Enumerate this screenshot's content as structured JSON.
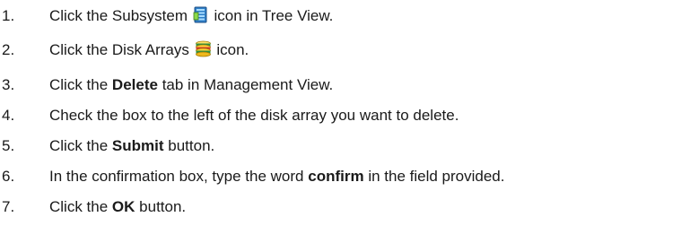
{
  "steps": [
    {
      "number": "1.",
      "before": "Click the Subsystem",
      "icon": "subsystem-icon",
      "after": "icon in Tree View."
    },
    {
      "number": "2.",
      "before": "Click the Disk Arrays",
      "icon": "disk-arrays-icon",
      "after": "icon."
    },
    {
      "number": "3.",
      "before": "Click the",
      "bold": "Delete",
      "after": "tab in Management View."
    },
    {
      "number": "4.",
      "text": "Check the box to the left of the disk array you want to delete."
    },
    {
      "number": "5.",
      "before": "Click the",
      "bold": "Submit",
      "after": "button."
    },
    {
      "number": "6.",
      "before": "In the confirmation box, type the word",
      "bold": "confirm",
      "after": "in the field provided."
    },
    {
      "number": "7.",
      "before": "Click the",
      "bold": "OK",
      "after": "button."
    }
  ]
}
